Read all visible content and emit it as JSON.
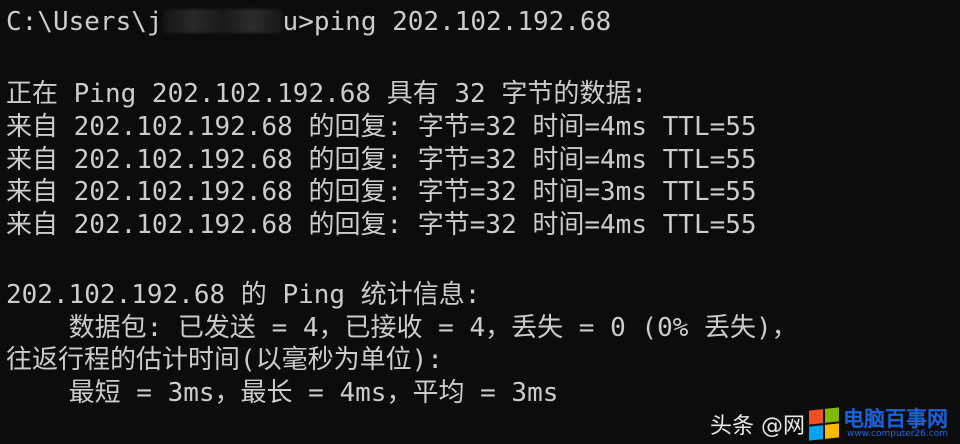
{
  "console": {
    "prompt_prefix": "C:\\Users\\j",
    "prompt_suffix": "u>ping 202.102.192.68",
    "pinging": "正在 Ping 202.102.192.68 具有 32 字节的数据:",
    "replies": [
      "来自 202.102.192.68 的回复: 字节=32 时间=4ms TTL=55",
      "来自 202.102.192.68 的回复: 字节=32 时间=4ms TTL=55",
      "来自 202.102.192.68 的回复: 字节=32 时间=3ms TTL=55",
      "来自 202.102.192.68 的回复: 字节=32 时间=4ms TTL=55"
    ],
    "stats_title": "202.102.192.68 的 Ping 统计信息:",
    "packets": "    数据包: 已发送 = 4，已接收 = 4，丢失 = 0 (0% 丢失)，",
    "rtt_title": "往返行程的估计时间(以毫秒为单位):",
    "rtt_values": "    最短 = 3ms，最长 = 4ms，平均 = 3ms"
  },
  "watermark": {
    "text": "头条 @网",
    "site_top": "电脑百事网",
    "site_bottom": "www.computer26.com",
    "logo_colors": [
      "#f25022",
      "#7fba00",
      "#00a4ef",
      "#ffb900"
    ]
  },
  "colors": {
    "background": "#0c0c0c",
    "text": "#cccccc"
  }
}
